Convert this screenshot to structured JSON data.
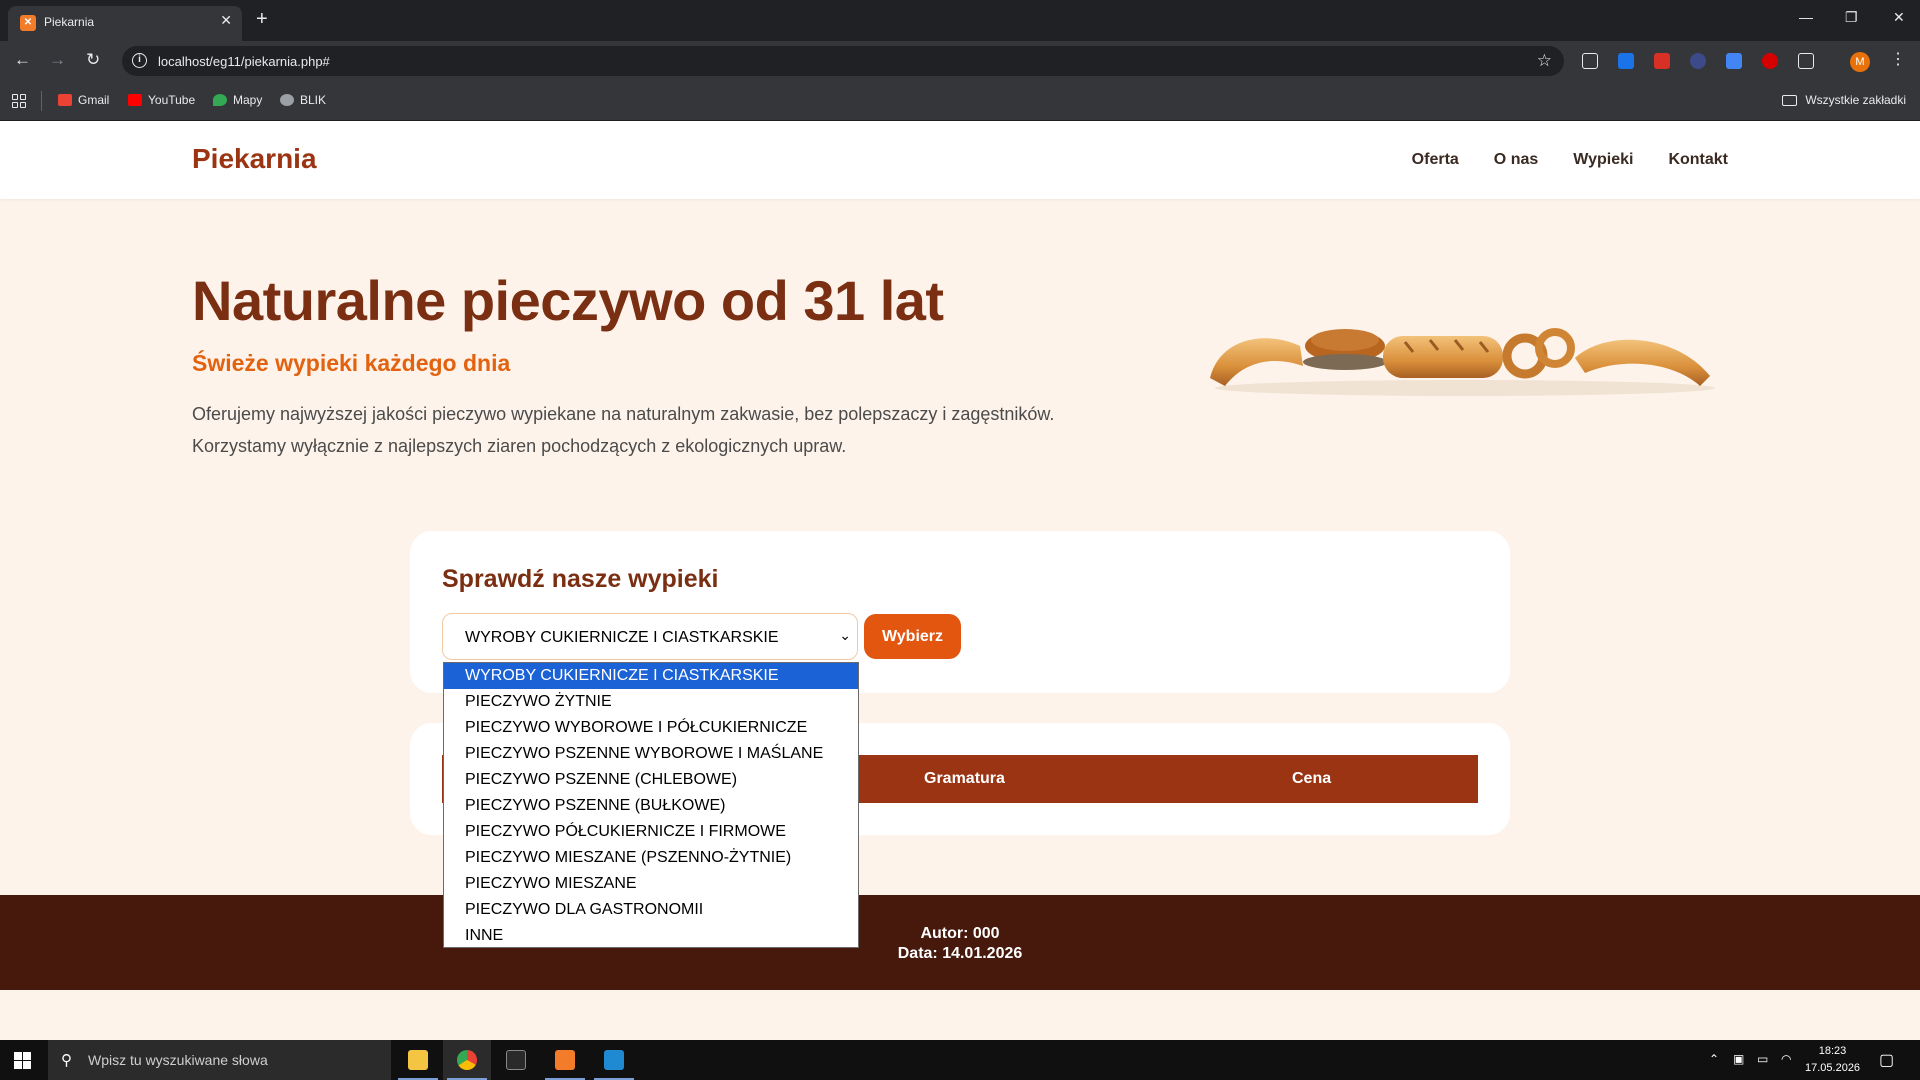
{
  "browser": {
    "tab_title": "Piekarnia",
    "tab_favicon": "xampp-icon",
    "url": "localhost/eg11/piekarnia.php#",
    "bookmarks": [
      {
        "label": "Gmail",
        "icon": "gmail-icon",
        "color": "#ea4335"
      },
      {
        "label": "YouTube",
        "icon": "youtube-icon",
        "color": "#ff0000"
      },
      {
        "label": "Mapy",
        "icon": "maps-icon",
        "color": "#34a853"
      },
      {
        "label": "BLIK",
        "icon": "globe-icon",
        "color": "#9aa0a6"
      }
    ],
    "all_bookmarks": "Wszystkie zakładki",
    "profile_initial": "M"
  },
  "site": {
    "brand": "Piekarnia",
    "nav": [
      "Oferta",
      "O nas",
      "Wypieki",
      "Kontakt"
    ],
    "hero": {
      "title": "Naturalne pieczywo od 31 lat",
      "subtitle": "Świeże wypieki każdego dnia",
      "text_line1": "Oferujemy najwyższej jakości pieczywo wypiekane na naturalnym zakwasie, bez polepszaczy i zagęstników.",
      "text_line2": "Korzystamy wyłącznie z najlepszych ziaren pochodzących z ekologicznych upraw."
    },
    "selector": {
      "title": "Sprawdź nasze wypieki",
      "selected": "WYROBY CUKIERNICZE I CIASTKARSKIE",
      "button": "Wybierz",
      "options": [
        "WYROBY CUKIERNICZE I CIASTKARSKIE",
        "PIECZYWO ŻYTNIE",
        "PIECZYWO WYBOROWE I PÓŁCUKIERNICZE",
        "PIECZYWO PSZENNE WYBOROWE I MAŚLANE",
        "PIECZYWO PSZENNE (CHLEBOWE)",
        "PIECZYWO PSZENNE (BUŁKOWE)",
        "PIECZYWO PÓŁCUKIERNICZE I FIRMOWE",
        "PIECZYWO MIESZANE (PSZENNO-ŻYTNIE)",
        "PIECZYWO MIESZANE",
        "PIECZYWO DLA GASTRONOMII",
        "INNE"
      ]
    },
    "table": {
      "headers": [
        "Gramatura",
        "Cena"
      ]
    },
    "footer": {
      "author": "Autor: 000",
      "date": "Data: 14.01.2026"
    },
    "colors": {
      "brand": "#9a3412",
      "accent": "#e2560f",
      "footer": "#47180c",
      "page_bg": "#fdf3ea"
    }
  },
  "taskbar": {
    "search_placeholder": "Wpisz tu wyszukiwane słowa",
    "apps": [
      "file-explorer-icon",
      "chrome-icon",
      "epic-games-icon",
      "xampp-icon",
      "vscode-icon"
    ],
    "time": "18:23",
    "date": "17.05.2026"
  }
}
